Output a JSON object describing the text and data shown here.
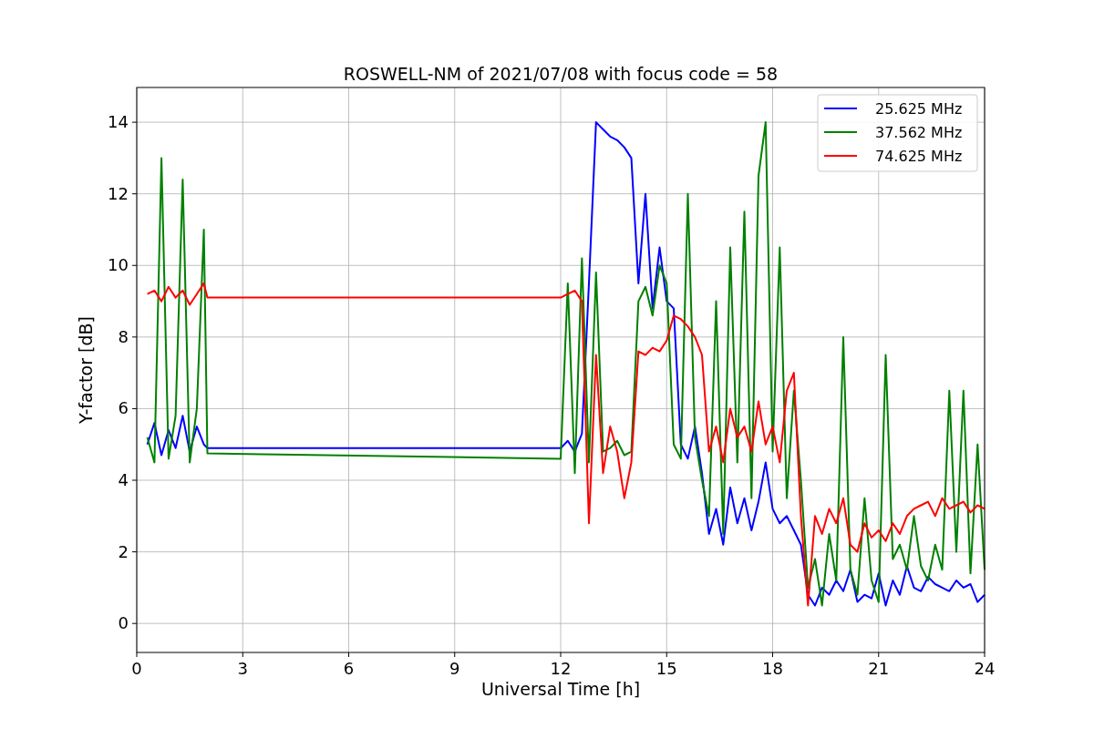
{
  "figure": {
    "chart_data": {
      "type": "line",
      "title": "ROSWELL-NM of 2021/07/08 with focus code = 58",
      "xlabel": "Universal Time [h]",
      "ylabel": "Y-factor [dB]",
      "x": [
        0.3,
        0.5,
        0.7,
        0.9,
        1.1,
        1.3,
        1.5,
        1.7,
        1.9,
        2.0,
        12.0,
        12.2,
        12.4,
        12.6,
        12.8,
        13.0,
        13.2,
        13.4,
        13.6,
        13.8,
        14.0,
        14.2,
        14.4,
        14.6,
        14.8,
        15.0,
        15.2,
        15.4,
        15.6,
        15.8,
        16.0,
        16.2,
        16.4,
        16.6,
        16.8,
        17.0,
        17.2,
        17.4,
        17.6,
        17.8,
        18.0,
        18.2,
        18.4,
        18.6,
        18.8,
        19.0,
        19.2,
        19.4,
        19.6,
        19.8,
        20.0,
        20.2,
        20.4,
        20.6,
        20.8,
        21.0,
        21.2,
        21.4,
        21.6,
        21.8,
        22.0,
        22.2,
        22.4,
        22.6,
        22.8,
        23.0,
        23.2,
        23.4,
        23.6,
        23.8,
        24.0
      ],
      "series": [
        {
          "name": "25.625 MHz",
          "color": "#0000ff",
          "values": [
            5.0,
            5.6,
            4.7,
            5.4,
            4.9,
            5.8,
            4.8,
            5.5,
            5.0,
            4.9,
            4.9,
            5.1,
            4.8,
            5.3,
            9.5,
            14.0,
            13.8,
            13.6,
            13.5,
            13.3,
            13.0,
            9.5,
            12.0,
            8.8,
            10.5,
            9.0,
            8.8,
            5.0,
            4.6,
            5.5,
            4.2,
            2.5,
            3.2,
            2.2,
            3.8,
            2.8,
            3.5,
            2.6,
            3.4,
            4.5,
            3.2,
            2.8,
            3.0,
            2.6,
            2.2,
            0.8,
            0.5,
            1.0,
            0.8,
            1.2,
            0.9,
            1.5,
            0.6,
            0.8,
            0.7,
            1.4,
            0.5,
            1.2,
            0.8,
            1.6,
            1.0,
            0.9,
            1.3,
            1.1,
            1.0,
            0.9,
            1.2,
            1.0,
            1.1,
            0.6,
            0.8
          ]
        },
        {
          "name": "37.562 MHz",
          "color": "#008000",
          "values": [
            5.2,
            4.5,
            13.0,
            4.6,
            5.8,
            12.4,
            4.5,
            6.0,
            11.0,
            4.75,
            4.6,
            9.5,
            4.2,
            10.2,
            4.5,
            9.8,
            4.8,
            4.9,
            5.1,
            4.7,
            4.8,
            9.0,
            9.4,
            8.6,
            10.0,
            9.5,
            5.0,
            4.6,
            12.0,
            5.2,
            4.0,
            3.0,
            9.0,
            2.5,
            10.5,
            4.5,
            11.5,
            3.5,
            12.5,
            14.0,
            4.8,
            10.5,
            3.5,
            6.5,
            4.0,
            1.0,
            1.8,
            0.5,
            2.5,
            1.2,
            8.0,
            1.5,
            0.8,
            3.5,
            1.2,
            0.6,
            7.5,
            1.8,
            2.2,
            1.5,
            3.0,
            1.6,
            1.2,
            2.2,
            1.5,
            6.5,
            2.0,
            6.5,
            1.4,
            5.0,
            1.5
          ]
        },
        {
          "name": "74.625 MHz",
          "color": "#ff0000",
          "values": [
            9.2,
            9.3,
            9.0,
            9.4,
            9.1,
            9.3,
            8.9,
            9.2,
            9.5,
            9.1,
            9.1,
            9.2,
            9.3,
            9.0,
            2.8,
            7.5,
            4.2,
            5.5,
            4.8,
            3.5,
            4.5,
            7.6,
            7.5,
            7.7,
            7.6,
            7.9,
            8.6,
            8.5,
            8.3,
            8.0,
            7.5,
            4.8,
            5.5,
            4.5,
            6.0,
            5.2,
            5.5,
            4.8,
            6.2,
            5.0,
            5.5,
            4.5,
            6.5,
            7.0,
            3.0,
            0.5,
            3.0,
            2.5,
            3.2,
            2.8,
            3.5,
            2.2,
            2.0,
            2.8,
            2.4,
            2.6,
            2.3,
            2.8,
            2.5,
            3.0,
            3.2,
            3.3,
            3.4,
            3.0,
            3.5,
            3.2,
            3.3,
            3.4,
            3.1,
            3.3,
            3.2
          ]
        }
      ],
      "grid": true,
      "legend": true,
      "xlim": [
        0,
        24
      ],
      "ylim": [
        -0.81,
        14.97
      ],
      "xticks": [
        0,
        3,
        6,
        9,
        12,
        15,
        18,
        21,
        24
      ],
      "yticks": [
        0,
        2,
        4,
        6,
        8,
        10,
        12,
        14
      ]
    }
  }
}
